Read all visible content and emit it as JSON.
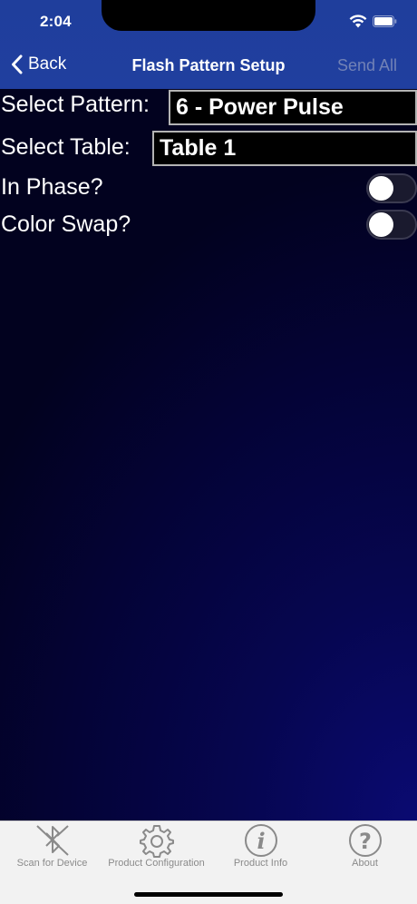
{
  "status_bar": {
    "time": "2:04"
  },
  "nav": {
    "back_label": "Back",
    "title": "Flash Pattern Setup",
    "send_all_label": "Send All"
  },
  "form": {
    "pattern_label": "Select Pattern:",
    "pattern_value": "6 - Power Pulse",
    "table_label": "Select Table:",
    "table_value": "Table 1",
    "in_phase_label": "In Phase?",
    "in_phase_on": false,
    "color_swap_label": "Color Swap?",
    "color_swap_on": false
  },
  "tabs": [
    {
      "label": "Scan for Device",
      "icon": "bluetooth-off-icon"
    },
    {
      "label": "Product Configuration",
      "icon": "gear-icon"
    },
    {
      "label": "Product Info",
      "icon": "info-icon"
    },
    {
      "label": "About",
      "icon": "question-icon"
    }
  ],
  "colors": {
    "nav_background": "#203f9f",
    "nav_disabled_text": "#7282b6",
    "content_gradient_dark": "#02021f",
    "content_gradient_light": "#0a0a72",
    "tab_inactive": "#8a8a8a"
  }
}
